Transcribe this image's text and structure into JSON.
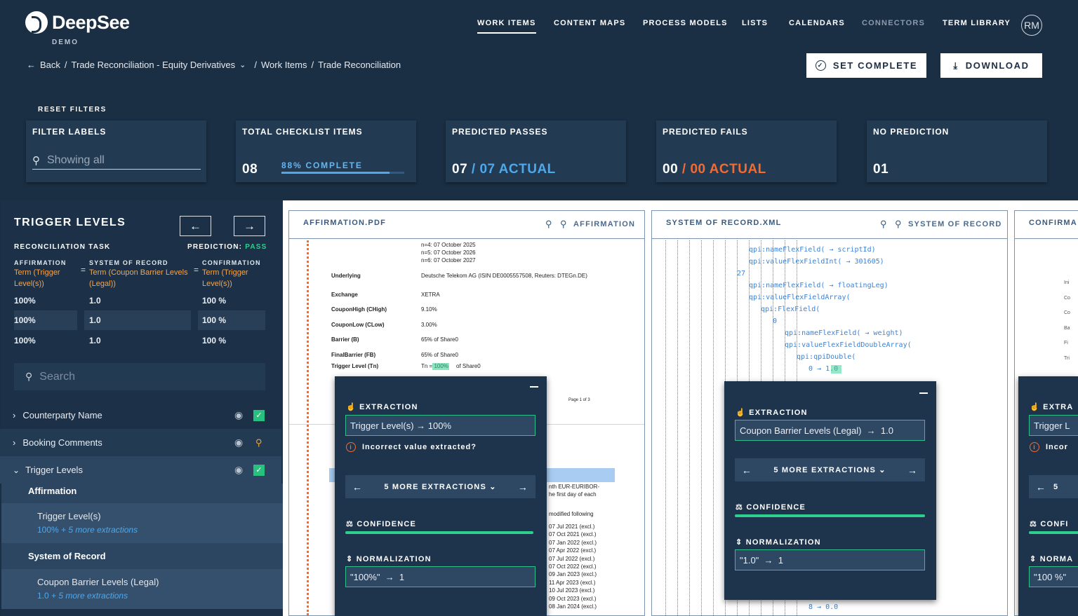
{
  "app": {
    "brand": "DeepSee",
    "sub": "DEMO",
    "avatar": "RM"
  },
  "nav": [
    "WORK ITEMS",
    "CONTENT MAPS",
    "PROCESS MODELS",
    "LISTS",
    "CALENDARS",
    "CONNECTORS",
    "TERM LIBRARY"
  ],
  "breadcrumb": {
    "back": "Back",
    "p1": "Trade Reconciliation - Equity Derivatives",
    "p2": "Work Items",
    "p3": "Trade Reconciliation",
    "sep": "/"
  },
  "actions": {
    "complete": "SET COMPLETE",
    "download": "DOWNLOAD"
  },
  "filters": {
    "reset": "RESET FILTERS",
    "labels_title": "FILTER LABELS",
    "labels_placeholder": "Showing all",
    "total_title": "TOTAL CHECKLIST ITEMS",
    "total_value": "08",
    "total_pct": "88% COMPLETE",
    "total_progress": 0.88,
    "passes_title": "PREDICTED PASSES",
    "passes_value": "07",
    "passes_actual": "/ 07 ACTUAL",
    "fails_title": "PREDICTED FAILS",
    "fails_value": "00",
    "fails_actual": "/ 00 ACTUAL",
    "nopred_title": "NO PREDICTION",
    "nopred_value": "01"
  },
  "side": {
    "title": "TRIGGER LEVELS",
    "task": "RECONCILIATION TASK",
    "pred_label": "PREDICTION:",
    "pred_value": "PASS",
    "cols": [
      {
        "head": "AFFIRMATION",
        "term": "Term (Trigger Level(s))"
      },
      {
        "head": "SYSTEM OF RECORD",
        "term": "Term (Coupon Barrier Levels (Legal))"
      },
      {
        "head": "CONFIRMATION",
        "term": "Term (Trigger Level(s))"
      }
    ],
    "eq": "=",
    "rows": [
      [
        "100%",
        "1.0",
        "100 %"
      ],
      [
        "100%",
        "1.0",
        "100 %"
      ],
      [
        "100%",
        "1.0",
        "100 %"
      ]
    ],
    "search": "Search",
    "items": [
      "Counterparty Name",
      "Booking Comments",
      "Trigger Levels"
    ],
    "sub1_head": "Affirmation",
    "sub1_term": "Trigger Level(s)",
    "sub1_val": "100%",
    "more": "+ 5 more extractions",
    "sub2_head": "System of Record",
    "sub2_term": "Coupon Barrier Levels (Legal)",
    "sub2_val": "1.0"
  },
  "pane1": {
    "title": "AFFIRMATION.PDF",
    "label": "AFFIRMATION",
    "top_lines": [
      "n=4: 07 October 2025",
      "n=5: 07 October 2026",
      "n=6: 07 October 2027"
    ],
    "fields": [
      [
        "Underlying",
        "Deutsche Telekom AG (ISIN DE0005557508, Reuters: DTEGn.DE)"
      ],
      [
        "Exchange",
        "XETRA"
      ],
      [
        "CouponHigh (CHigh)",
        "9.10%"
      ],
      [
        "CouponLow (CLow)",
        "3.00%"
      ],
      [
        "Barrier (B)",
        "65% of Share0"
      ],
      [
        "FinalBarrier (FB)",
        "65% of Share0"
      ],
      [
        "Trigger Level (Tn)",
        "Tn = 100%     of Share0"
      ]
    ],
    "page": "Page 1 of 3",
    "euribor": [
      "nth EUR-EURIBOR-",
      "he first day of each"
    ],
    "modified": "modified following",
    "dates": [
      "07 Jul 2021 (excl.)",
      "07 Oct 2021 (excl.)",
      "07 Jan 2022 (excl.)",
      "07 Apr 2022 (excl.)",
      "07 Jul 2022 (excl.)",
      "07 Oct 2022 (excl.)",
      "09 Jan 2023 (excl.)",
      "11 Apr 2023 (excl.)",
      "10 Jul 2023 (excl.)",
      "09 Oct 2023 (excl.)",
      "08 Jan 2024 (excl.)"
    ]
  },
  "pop1": {
    "ext": "EXTRACTION",
    "ext_val": "Trigger Level(s)  →  100%",
    "warn": "Incorrect value extracted?",
    "more": "5 MORE EXTRACTIONS",
    "conf": "CONFIDENCE",
    "confidence": 1.0,
    "norm": "NORMALIZATION",
    "norm_val": "\"100%\"  →  1"
  },
  "pane2": {
    "title": "SYSTEM OF RECORD.XML",
    "label": "SYSTEM OF RECORD",
    "code": [
      "qpi:nameFlexField( → scriptId)",
      "qpi:valueFlexFieldInt( → 301605)",
      "27",
      "qpi:nameFlexField( → floatingLeg)",
      "qpi:valueFlexFieldArray(",
      "qpi:FlexField(",
      "0",
      "qpi:nameFlexField( → weight)",
      "qpi:valueFlexFieldDoubleArray(",
      "qpi:qpiDouble(",
      "0 → 1.0",
      "8 → 0.0"
    ]
  },
  "pop2": {
    "ext": "EXTRACTION",
    "ext_val": "Coupon Barrier Levels (Legal)  →  1.0",
    "more": "5 MORE EXTRACTIONS",
    "conf": "CONFIDENCE",
    "confidence": 1.0,
    "norm": "NORMALIZATION",
    "norm_val": "\"1.0\"  →  1"
  },
  "pane3": {
    "title": "CONFIRMA",
    "ext": "EXTRA",
    "ext_val": "Trigger L",
    "warn": "Incor",
    "more": "5",
    "conf": "CONFI",
    "norm": "NORMA",
    "norm_val": "\"100 %\"",
    "edge": [
      "Ini",
      "Co",
      "Co",
      "Ba",
      "Fi",
      "Tri"
    ]
  }
}
